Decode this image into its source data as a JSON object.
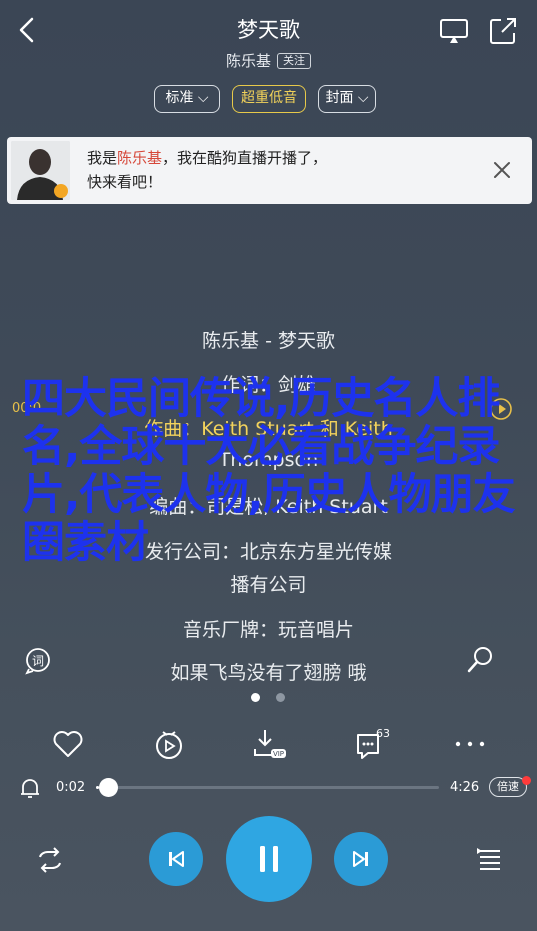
{
  "header": {
    "title": "梦天歌",
    "artist": "陈乐基",
    "follow_label": "关注"
  },
  "pills": {
    "quality": "标准",
    "bass": "超重低音",
    "cover": "封面"
  },
  "notice": {
    "prefix": "我是",
    "name": "陈乐基",
    "rest": "，我在酷狗直播开播了，",
    "line2": "快来看吧！"
  },
  "lyrics": {
    "song_title": "陈乐基 - 梦天歌",
    "lines": [
      "作词：剑雄",
      "作曲：Keith Stuart 和 Keith",
      "Thompson",
      "编曲：司是松, Keith Stuart",
      "发行公司：北京东方星光传媒",
      "播有公司",
      "音乐厂牌：玩音唱片",
      "如果飞鸟没有了翅膀 哦"
    ],
    "mini_time": "00:0"
  },
  "watermark": {
    "text": "四大民间传说,历史名人排名,全球十大必看战争纪录片,代表人物,历史人物朋友圈素材"
  },
  "actions": {
    "comment_count": "63"
  },
  "progress": {
    "current": "0:02",
    "total": "4:26",
    "fraction": 0.008,
    "speed_label": "倍速"
  },
  "colors": {
    "accent": "#2fa6e2",
    "highlight_name": "#d6483a",
    "bass_pill": "#f0d15a",
    "watermark": "#1d32ee"
  }
}
